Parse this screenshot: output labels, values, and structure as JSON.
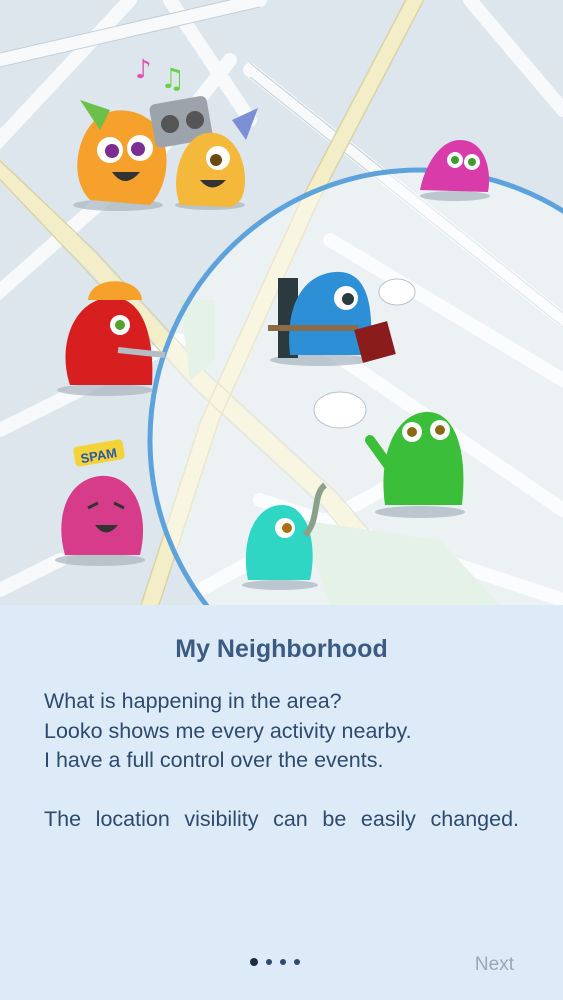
{
  "onboarding": {
    "title": "My Neighborhood",
    "lines": [
      "What is happening in the area?",
      "Looko shows me every activity nearby.",
      "I have a full control over the events."
    ],
    "visibility_text": "The location visibility can be easily changed.",
    "next_label": "Next",
    "page_indicator": {
      "total": 4,
      "current": 1
    }
  },
  "illustration": {
    "badge_text": "SPAM",
    "map_highlight_color": "#5ea2dc",
    "characters": [
      "orange-monster-party-hat-icon",
      "yellow-monster-boombox-icon",
      "pink-monster-icon",
      "red-monster-hardhat-icon",
      "blue-monster-reading-icon",
      "green-monster-speech-icon",
      "magenta-monster-spam-icon",
      "teal-monster-waving-icon"
    ]
  }
}
